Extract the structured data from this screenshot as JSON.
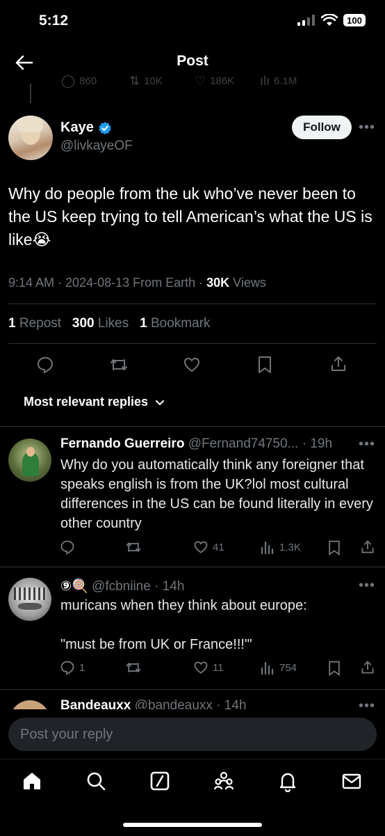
{
  "status_bar": {
    "time": "5:12",
    "battery": "100"
  },
  "header": {
    "title": "Post"
  },
  "ghost_row": {
    "replies": "860",
    "reposts": "10K",
    "likes": "186K",
    "views": "6.1M"
  },
  "post": {
    "author_name": "Kaye",
    "author_handle": "@livkayeOF",
    "follow_label": "Follow",
    "text": "Why do people from the uk who’ve never been to the US keep trying to tell American’s what the US is like😭",
    "meta_time": "9:14 AM · 2024-08-13 From Earth · ",
    "meta_views_count": "30K",
    "meta_views_label": " Views",
    "repost_count": "1",
    "repost_label": "Repost",
    "likes_count": "300",
    "likes_label": "Likes",
    "bookmark_count": "1",
    "bookmark_label": "Bookmark"
  },
  "replies_filter": {
    "label": "Most relevant replies"
  },
  "replies": [
    {
      "name": "Fernando Guerreiro",
      "handle": "@Fernand74750...",
      "time": "· 19h",
      "text": "Why do you automatically think any foreigner that speaks english is from the UK?lol most cultural differences in the US can be found literally in every other country",
      "replies": "",
      "likes": "41",
      "views": "1.3K"
    },
    {
      "name": "⑨🍭",
      "handle": "@fcbniine",
      "time": "· 14h",
      "text": "muricans when they think about europe:\n\n\"must be from UK or France!!!\"'",
      "replies": "1",
      "likes": "11",
      "views": "754"
    },
    {
      "name": "Bandeauxx",
      "handle": "@bandeauxx",
      "time": "· 14h"
    }
  ],
  "composer": {
    "placeholder": "Post your reply"
  },
  "colors": {
    "accent": "#1d9bf0",
    "background": "#000000",
    "muted": "#71767b"
  },
  "tab_icons": [
    "home-icon",
    "search-icon",
    "grok-icon",
    "communities-icon",
    "notifications-icon",
    "messages-icon"
  ]
}
